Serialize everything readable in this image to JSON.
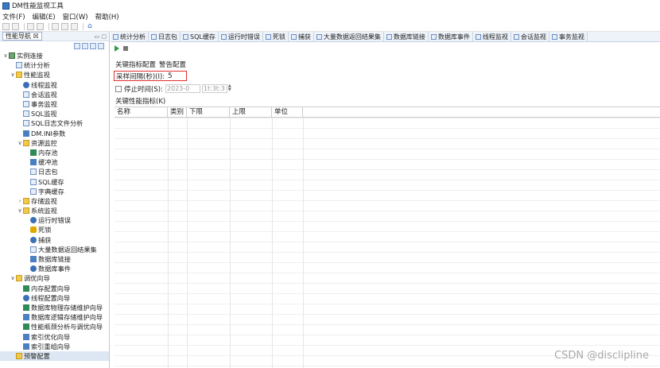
{
  "window": {
    "title": "DM性能监视工具"
  },
  "menu": [
    "文件(F)",
    "编辑(E)",
    "窗口(W)",
    "帮助(H)"
  ],
  "left_panel": {
    "tab_label": "性能导航",
    "tab_close": "☒",
    "tree": [
      {
        "level": 0,
        "twisty": "∨",
        "icon": "root",
        "label": "实例连接"
      },
      {
        "level": 1,
        "twisty": "",
        "icon": "doc",
        "label": "统计分析"
      },
      {
        "level": 1,
        "twisty": "∨",
        "icon": "folder",
        "label": "性能监视"
      },
      {
        "level": 2,
        "twisty": "",
        "icon": "gear",
        "label": "线程监视"
      },
      {
        "level": 2,
        "twisty": "",
        "icon": "doc",
        "label": "会话监视"
      },
      {
        "level": 2,
        "twisty": "",
        "icon": "doc",
        "label": "事务监视"
      },
      {
        "level": 2,
        "twisty": "",
        "icon": "doc",
        "label": "SQL监视"
      },
      {
        "level": 2,
        "twisty": "",
        "icon": "doc",
        "label": "SQL日志文件分析"
      },
      {
        "level": 2,
        "twisty": "",
        "icon": "blue",
        "label": "DM.INI参数"
      },
      {
        "level": 2,
        "twisty": "∨",
        "icon": "folder",
        "label": "资源监控"
      },
      {
        "level": 3,
        "twisty": "",
        "icon": "green",
        "label": "内存池"
      },
      {
        "level": 3,
        "twisty": "",
        "icon": "blue",
        "label": "缓冲池"
      },
      {
        "level": 3,
        "twisty": "",
        "icon": "doc",
        "label": "日志包"
      },
      {
        "level": 3,
        "twisty": "",
        "icon": "doc",
        "label": "SQL缓存"
      },
      {
        "level": 3,
        "twisty": "",
        "icon": "doc",
        "label": "字典缓存"
      },
      {
        "level": 2,
        "twisty": "›",
        "icon": "folder",
        "label": "存储监视"
      },
      {
        "level": 2,
        "twisty": "∨",
        "icon": "folder",
        "label": "系统监视"
      },
      {
        "level": 3,
        "twisty": "",
        "icon": "gear",
        "label": "运行时错误"
      },
      {
        "level": 3,
        "twisty": "",
        "icon": "lock",
        "label": "死锁"
      },
      {
        "level": 3,
        "twisty": "",
        "icon": "gear",
        "label": "捕获"
      },
      {
        "level": 3,
        "twisty": "",
        "icon": "doc",
        "label": "大量数据返回结果集"
      },
      {
        "level": 3,
        "twisty": "",
        "icon": "blue",
        "label": "数据库链接"
      },
      {
        "level": 3,
        "twisty": "",
        "icon": "gear",
        "label": "数据库事件"
      },
      {
        "level": 1,
        "twisty": "∨",
        "icon": "folder",
        "label": "调优向导"
      },
      {
        "level": 2,
        "twisty": "",
        "icon": "green",
        "label": "内存配置向导"
      },
      {
        "level": 2,
        "twisty": "",
        "icon": "gear",
        "label": "线程配置向导"
      },
      {
        "level": 2,
        "twisty": "",
        "icon": "green",
        "label": "数据库物理存储维护向导"
      },
      {
        "level": 2,
        "twisty": "",
        "icon": "blue",
        "label": "数据库逻辑存储维护向导"
      },
      {
        "level": 2,
        "twisty": "",
        "icon": "green",
        "label": "性能瓶颈分析与调优向导"
      },
      {
        "level": 2,
        "twisty": "",
        "icon": "blue",
        "label": "索引优化向导"
      },
      {
        "level": 2,
        "twisty": "",
        "icon": "blue",
        "label": "索引重组向导"
      },
      {
        "level": 1,
        "twisty": "",
        "icon": "folder",
        "label": "预警配置",
        "selected": true
      }
    ]
  },
  "editor_tabs": [
    "统计分析",
    "日志包",
    "SQL缓存",
    "运行时错误",
    "死锁",
    "捕获",
    "大量数据返回结果集",
    "数据库链接",
    "数据库事件",
    "线程监视",
    "会话监视",
    "事务监视"
  ],
  "alert_config": {
    "subtabs": [
      "关键指标配置",
      "警告配置"
    ],
    "sample_label": "采样间隔(秒)(I):",
    "sample_value": "5",
    "stop_label": "停止时间(S):",
    "stop_date": "2023-0",
    "stop_time": "1t:3t:3",
    "kpi_label": "关键性能指标(K)",
    "columns": [
      "名称",
      "类别",
      "下限",
      "上限",
      "单位"
    ]
  },
  "watermark": "CSDN @disclipline",
  "colors": {
    "highlight_border": "#e03030",
    "run_green": "#2e9e4a"
  }
}
